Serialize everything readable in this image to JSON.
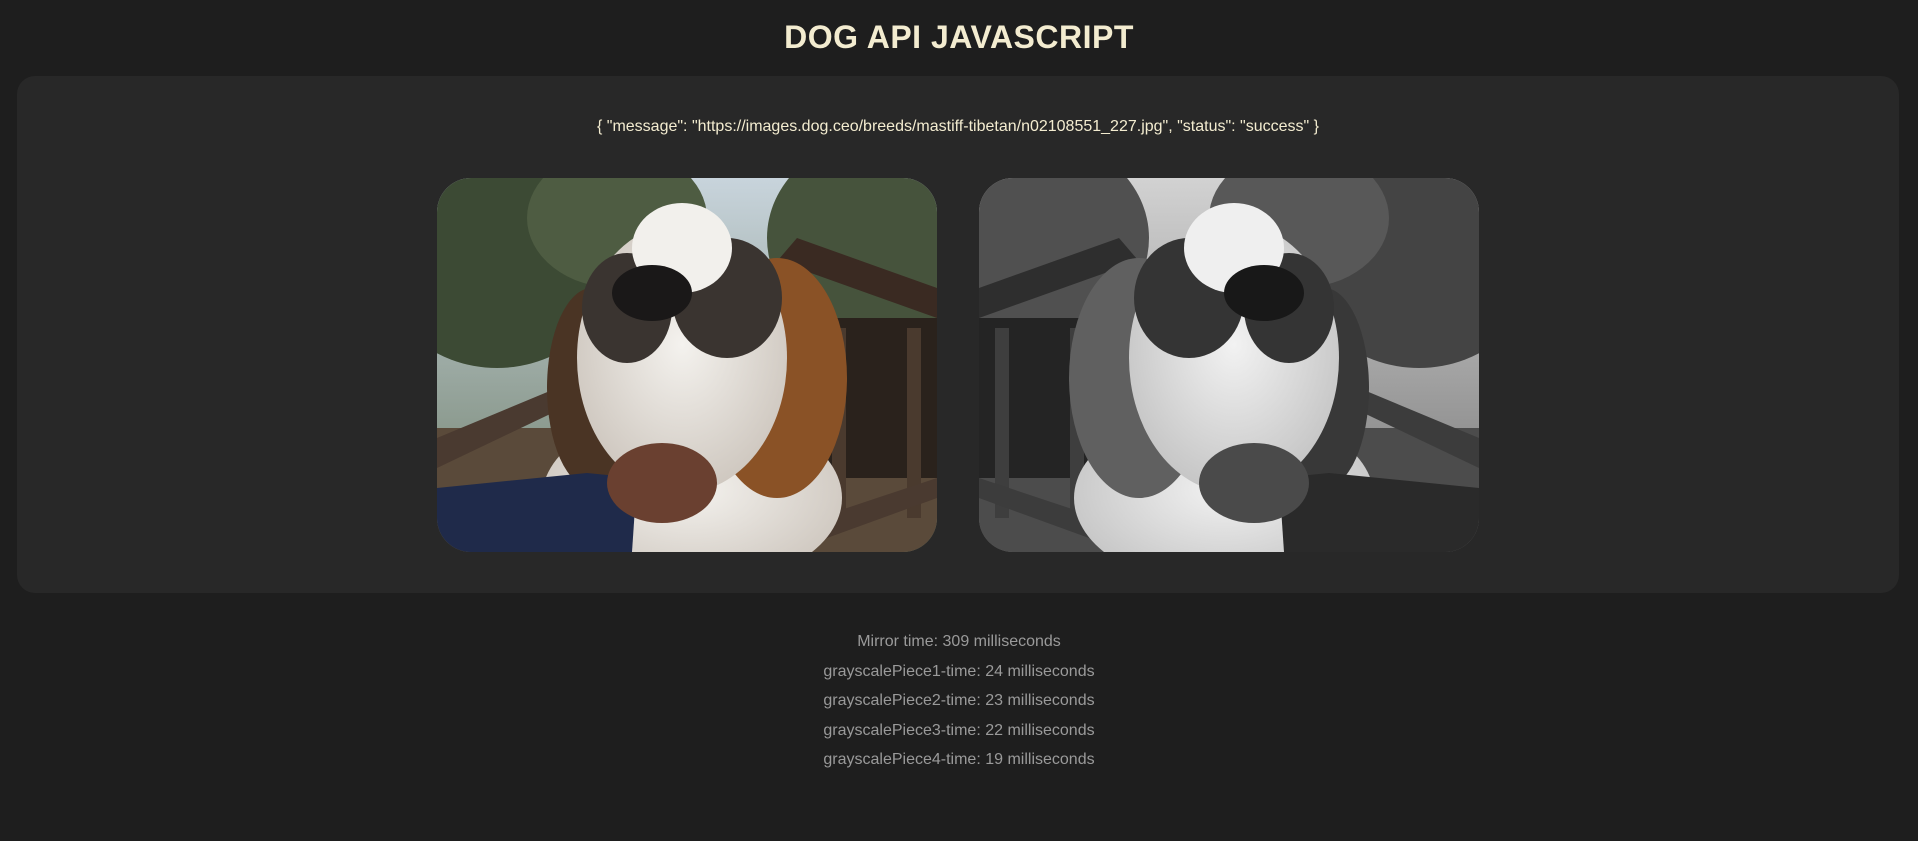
{
  "header": {
    "title": "DOG API JAVASCRIPT"
  },
  "api": {
    "response_text": "{ \"message\": \"https://images.dog.ceo/breeds/mastiff-tibetan/n02108551_227.jpg\", \"status\": \"success\" }"
  },
  "images": {
    "original": {
      "subject": "dog-photo",
      "filter": "none"
    },
    "processed": {
      "subject": "dog-photo",
      "filter": "mirrored-grayscale"
    }
  },
  "timings": [
    {
      "text": "Mirror time: 309 milliseconds"
    },
    {
      "text": "grayscalePiece1-time: 24 milliseconds"
    },
    {
      "text": "grayscalePiece2-time: 23 milliseconds"
    },
    {
      "text": "grayscalePiece3-time: 22 milliseconds"
    },
    {
      "text": "grayscalePiece4-time: 19 milliseconds"
    }
  ],
  "colors": {
    "background": "#1e1e1e",
    "panel": "#282828",
    "title": "#f3ecd0",
    "muted_text": "#9a9a9a"
  }
}
